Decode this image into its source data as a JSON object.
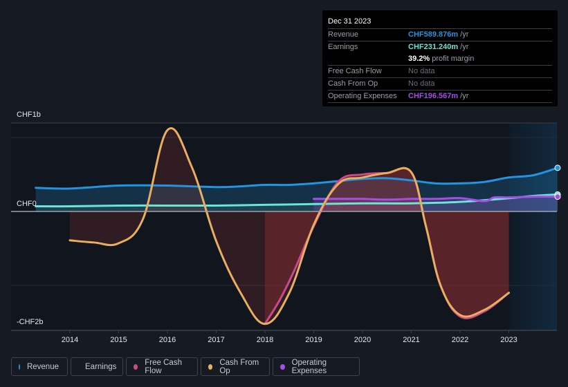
{
  "tooltip": {
    "date": "Dec 31 2023",
    "rows": [
      {
        "label": "Revenue",
        "value": "CHF589.876m",
        "unit": "/yr",
        "color": "#2394df"
      },
      {
        "label": "Earnings",
        "value": "CHF231.240m",
        "unit": "/yr",
        "color": "#6ce5d5"
      },
      {
        "label": "",
        "value": "39.2%",
        "unit": "profit margin",
        "color": "#ffffff"
      },
      {
        "label": "Free Cash Flow",
        "value": "No data",
        "unit": "",
        "color": "#6b6f76"
      },
      {
        "label": "Cash From Op",
        "value": "No data",
        "unit": "",
        "color": "#6b6f76"
      },
      {
        "label": "Operating Expenses",
        "value": "CHF196.567m",
        "unit": "/yr",
        "color": "#a64ee8"
      }
    ]
  },
  "legend": [
    {
      "label": "Revenue",
      "color": "#2394df"
    },
    {
      "label": "Earnings",
      "color": "#6ce5d5"
    },
    {
      "label": "Free Cash Flow",
      "color": "#c94a87"
    },
    {
      "label": "Cash From Op",
      "color": "#e9ae5f"
    },
    {
      "label": "Operating Expenses",
      "color": "#a64ee8"
    }
  ],
  "chart_data": {
    "type": "line",
    "title": "",
    "xlabel": "",
    "ylabel": "",
    "y_unit": "CHF billions",
    "y_tick_labels": [
      "CHF1b",
      "CHF0",
      "-CHF2b"
    ],
    "x_tick_labels": [
      "2014",
      "2015",
      "2016",
      "2017",
      "2018",
      "2019",
      "2020",
      "2021",
      "2022",
      "2023"
    ],
    "xlim": [
      2013.3,
      2024.0
    ],
    "ylim": [
      -1.6,
      1.2
    ],
    "grid": true,
    "legend_position": "bottom",
    "forecast_shade_from": 2023.0,
    "series": [
      {
        "name": "Revenue",
        "color": "#2394df",
        "x": [
          2013.3,
          2014,
          2015,
          2016,
          2017,
          2017.5,
          2018,
          2018.5,
          2019,
          2019.5,
          2020,
          2020.5,
          2021,
          2021.5,
          2022,
          2022.5,
          2023,
          2023.5,
          2024.0
        ],
        "y": [
          0.32,
          0.31,
          0.35,
          0.35,
          0.33,
          0.34,
          0.36,
          0.36,
          0.38,
          0.41,
          0.44,
          0.45,
          0.42,
          0.38,
          0.38,
          0.4,
          0.46,
          0.49,
          0.59
        ]
      },
      {
        "name": "Earnings",
        "color": "#6ce5d5",
        "x": [
          2013.3,
          2014,
          2015,
          2016,
          2017,
          2018,
          2019,
          2020,
          2021,
          2022,
          2023,
          2023.5,
          2024.0
        ],
        "y": [
          0.07,
          0.07,
          0.08,
          0.08,
          0.08,
          0.09,
          0.1,
          0.11,
          0.11,
          0.13,
          0.18,
          0.21,
          0.23
        ]
      },
      {
        "name": "Free Cash Flow",
        "color": "#c94a87",
        "x": [
          2018,
          2018.3,
          2018.6,
          2019,
          2019.5,
          2020,
          2020.5,
          2021,
          2021.3,
          2021.6,
          2022,
          2022.5,
          2023
        ],
        "y": [
          -1.52,
          -1.2,
          -0.8,
          -0.2,
          0.4,
          0.5,
          0.52,
          0.53,
          -0.2,
          -1.0,
          -1.42,
          -1.35,
          -1.1
        ]
      },
      {
        "name": "Cash From Op",
        "color": "#e9ae5f",
        "x": [
          2014,
          2014.5,
          2015,
          2015.5,
          2016,
          2016.5,
          2017,
          2017.5,
          2018,
          2018.5,
          2019,
          2019.5,
          2020,
          2020.5,
          2021,
          2021.3,
          2021.6,
          2022,
          2022.5,
          2023
        ],
        "y": [
          -0.39,
          -0.42,
          -0.43,
          -0.1,
          1.1,
          0.6,
          -0.4,
          -1.1,
          -1.52,
          -1.1,
          -0.18,
          0.37,
          0.46,
          0.52,
          0.53,
          -0.2,
          -1.0,
          -1.4,
          -1.33,
          -1.1
        ]
      },
      {
        "name": "Operating Expenses",
        "color": "#a64ee8",
        "x": [
          2019,
          2019.5,
          2020,
          2020.5,
          2021,
          2021.5,
          2022,
          2022.5,
          2022.7,
          2023,
          2023.5,
          2024.0
        ],
        "y": [
          0.17,
          0.17,
          0.17,
          0.16,
          0.17,
          0.17,
          0.18,
          0.14,
          0.19,
          0.19,
          0.2,
          0.2
        ]
      }
    ]
  }
}
